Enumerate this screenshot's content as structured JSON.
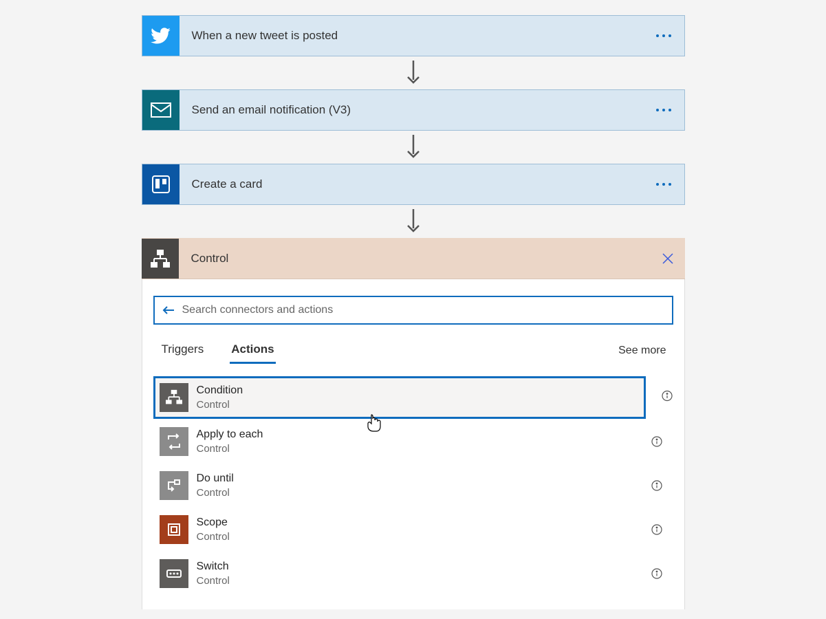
{
  "flow_steps": [
    {
      "id": "twitter-trigger",
      "label": "When a new tweet is posted"
    },
    {
      "id": "email-action",
      "label": "Send an email notification (V3)"
    },
    {
      "id": "trello-action",
      "label": "Create a card"
    }
  ],
  "control_panel": {
    "title": "Control",
    "search_placeholder": "Search connectors and actions",
    "tabs": {
      "triggers": "Triggers",
      "actions": "Actions"
    },
    "see_more": "See more",
    "actions_list": [
      {
        "id": "condition",
        "title": "Condition",
        "sub": "Control"
      },
      {
        "id": "apply-each",
        "title": "Apply to each",
        "sub": "Control"
      },
      {
        "id": "do-until",
        "title": "Do until",
        "sub": "Control"
      },
      {
        "id": "scope",
        "title": "Scope",
        "sub": "Control"
      },
      {
        "id": "switch",
        "title": "Switch",
        "sub": "Control"
      }
    ]
  }
}
